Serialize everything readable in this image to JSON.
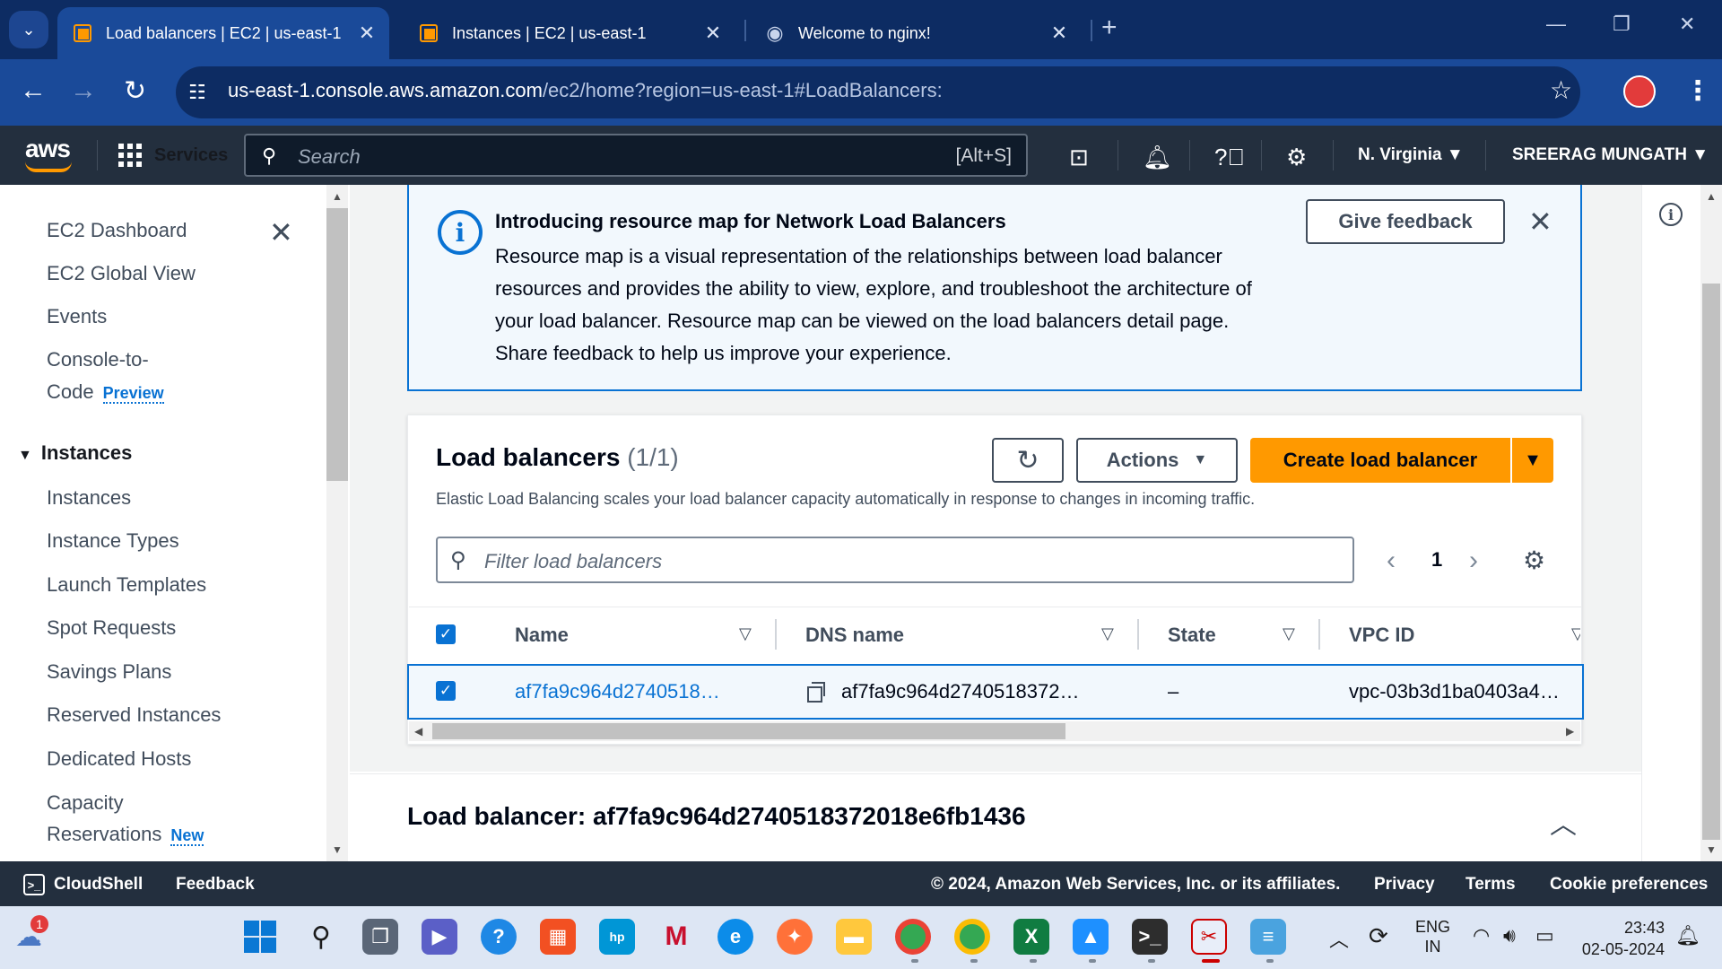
{
  "browser": {
    "tabs": [
      {
        "title": "Load balancers | EC2 | us-east-1",
        "active": true
      },
      {
        "title": "Instances | EC2 | us-east-1",
        "active": false
      },
      {
        "title": "Welcome to nginx!",
        "active": false
      }
    ],
    "url_host": "us-east-1.console.aws.amazon.com",
    "url_path": "/ec2/home?region=us-east-1#LoadBalancers:"
  },
  "awsnav": {
    "logo": "aws",
    "services_label": "Services",
    "search_placeholder": "Search",
    "search_shortcut": "[Alt+S]",
    "region": "N. Virginia",
    "user": "SREERAG MUNGATH"
  },
  "sidenav": {
    "items_top": [
      "EC2 Dashboard",
      "EC2 Global View",
      "Events"
    ],
    "console_to_code_line1": "Console-to-",
    "console_to_code_line2": "Code",
    "preview_badge": "Preview",
    "section_instances": "Instances",
    "instances_items": [
      "Instances",
      "Instance Types",
      "Launch Templates",
      "Spot Requests",
      "Savings Plans",
      "Reserved Instances",
      "Dedicated Hosts"
    ],
    "capacity_line1": "Capacity",
    "capacity_line2": "Reservations",
    "new_badge": "New"
  },
  "flash": {
    "title": "Introducing resource map for Network Load Balancers",
    "body": "Resource map is a visual representation of the relationships between load balancer resources and provides the ability to view, explore, and troubleshoot the architecture of your load balancer. Resource map can be viewed on the load balancers detail page. Share feedback to help us improve your experience.",
    "feedback_label": "Give feedback"
  },
  "table": {
    "title": "Load balancers",
    "count": "(1/1)",
    "description": "Elastic Load Balancing scales your load balancer capacity automatically in response to changes in incoming traffic.",
    "actions_label": "Actions",
    "create_label": "Create load balancer",
    "filter_placeholder": "Filter load balancers",
    "page": "1",
    "columns": [
      "Name",
      "DNS name",
      "State",
      "VPC ID"
    ],
    "rows": [
      {
        "name": "af7fa9c964d2740518…",
        "dns": "af7fa9c964d2740518372…",
        "state": "–",
        "vpc": "vpc-03b3d1ba0403a4…"
      }
    ]
  },
  "detail": {
    "title": "Load balancer: af7fa9c964d2740518372018e6fb1436"
  },
  "footer": {
    "cloudshell": "CloudShell",
    "feedback": "Feedback",
    "copyright": "© 2024, Amazon Web Services, Inc. or its affiliates.",
    "privacy": "Privacy",
    "terms": "Terms",
    "cookie": "Cookie preferences"
  },
  "taskbar": {
    "lang_line1": "ENG",
    "lang_line2": "IN",
    "time": "23:43",
    "date": "02-05-2024",
    "notification_count": "1"
  },
  "colors": {
    "aws_orange": "#ff9900",
    "aws_nav": "#232f3e",
    "link_blue": "#0972d3",
    "browser_frame": "#0d2c63"
  }
}
